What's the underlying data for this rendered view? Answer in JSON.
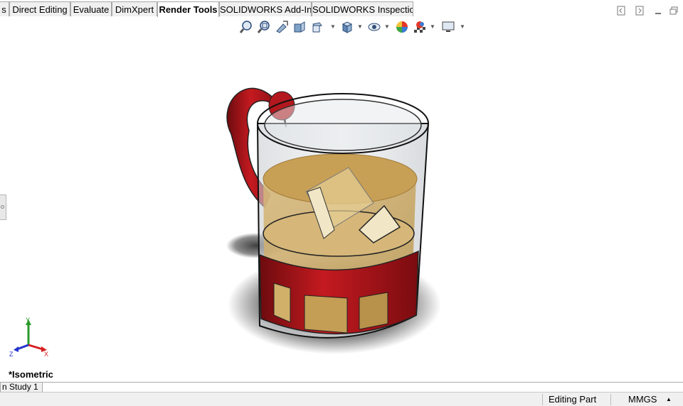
{
  "tabs": [
    {
      "label": "s"
    },
    {
      "label": "Direct Editing"
    },
    {
      "label": "Evaluate"
    },
    {
      "label": "DimXpert"
    },
    {
      "label": "Render Tools"
    },
    {
      "label": "SOLIDWORKS Add-Ins"
    },
    {
      "label": "SOLIDWORKS Inspection"
    }
  ],
  "active_tab": "Render Tools",
  "viewport": {
    "view_orientation": "*Isometric",
    "triad": {
      "x": "X",
      "y": "Y",
      "z": "Z"
    }
  },
  "bottom_tabs": [
    {
      "label": "n Study 1"
    }
  ],
  "status": {
    "mode": "Editing Part",
    "units": "MMGS",
    "units_arrow": "▲"
  },
  "colors": {
    "handle_red": "#b8151b",
    "liquid": "#c9a458",
    "glass": "#d9dde0",
    "triad_x": "#d62020",
    "triad_y": "#2a9a2a",
    "triad_z": "#2233cc"
  },
  "icons": [
    "zoom-to-fit-icon",
    "zoom-area-icon",
    "previous-view-icon",
    "section-view-icon",
    "view-orientation-icon",
    "display-style-icon",
    "hide-show-icon",
    "edit-appearance-icon",
    "apply-scene-icon",
    "view-settings-icon"
  ]
}
